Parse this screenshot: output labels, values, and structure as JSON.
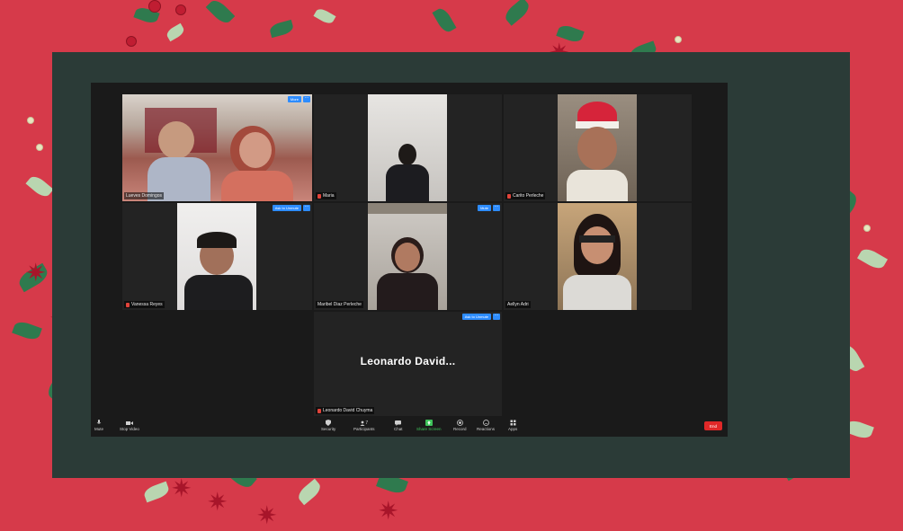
{
  "meeting": {
    "participants": [
      {
        "name": "Lueves Domingos",
        "mic_muted": false,
        "speaking": true,
        "button": "More"
      },
      {
        "name": "Maria",
        "mic_muted": true,
        "speaking": false,
        "button": ""
      },
      {
        "name": "Carito Perleche",
        "mic_muted": true,
        "speaking": false,
        "button": ""
      },
      {
        "name": "Vanessa Reyes",
        "mic_muted": true,
        "speaking": false,
        "button": "Ask to Unmute"
      },
      {
        "name": "Maribel Diaz Perleche",
        "mic_muted": false,
        "speaking": false,
        "button": "Mute"
      },
      {
        "name": "Aellyn Adri",
        "mic_muted": false,
        "speaking": false,
        "button": ""
      },
      {
        "name": "Leonardo David Chuyma",
        "mic_muted": true,
        "speaking": false,
        "button": "Ask to Unmute",
        "display_name": "Leonardo  David..."
      }
    ],
    "more_glyph": "···"
  },
  "toolbar": {
    "mute_label": "Mute",
    "stop_video_label": "Stop Video",
    "security_label": "Security",
    "participants_label": "Participants",
    "participants_count": "7",
    "chat_label": "Chat",
    "share_screen_label": "Share Screen",
    "record_label": "Record",
    "reactions_label": "Reactions",
    "apps_label": "Apps",
    "end_label": "End"
  },
  "colors": {
    "background": "#d63a4a",
    "board": "#2b3b37",
    "accent_blue": "#2d8cff",
    "end_red": "#e02828",
    "share_green": "#3ec35a"
  }
}
